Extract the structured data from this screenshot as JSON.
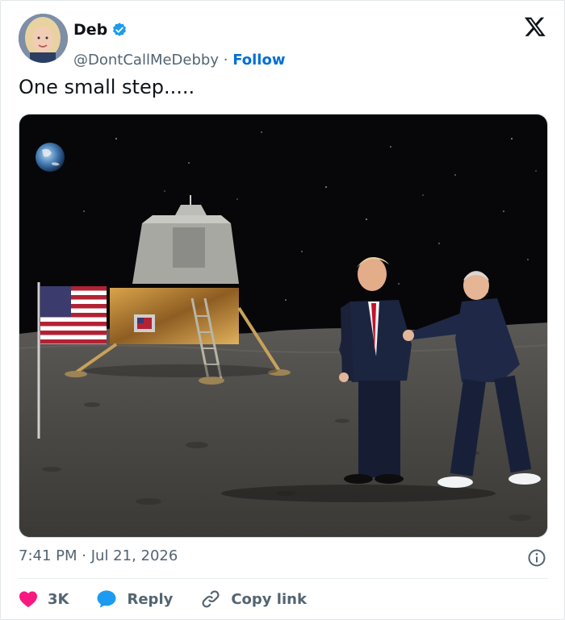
{
  "author": {
    "display_name": "Deb",
    "handle": "@DontCallMeDebby",
    "separator": "·",
    "follow_label": "Follow"
  },
  "tweet": {
    "text": "One small step....."
  },
  "media": {
    "alt": "",
    "flag_label": ""
  },
  "meta": {
    "time": "7:41 PM",
    "separator": "·",
    "date": "Jul 21, 2026"
  },
  "actions": {
    "like_count": "3K",
    "reply_label": "Reply",
    "copy_link_label": "Copy link"
  },
  "colors": {
    "brand_blue": "#1d9bf0",
    "follow_blue": "#006fd6",
    "like_pink": "#f91880",
    "muted": "#536471"
  },
  "icons": [
    "verified-badge-icon",
    "x-logo-icon",
    "info-icon",
    "heart-icon",
    "reply-bubble-icon",
    "link-icon"
  ]
}
